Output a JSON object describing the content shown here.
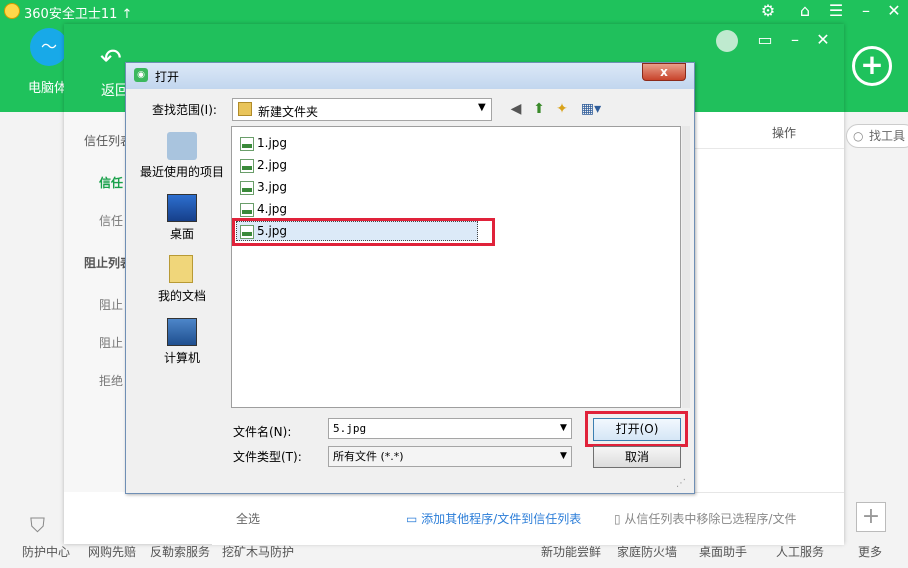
{
  "app": {
    "title": "360安全卫士11 ↑",
    "tool_label": "电脑体",
    "big_plus": "+"
  },
  "inner": {
    "back_icon": "↶",
    "back_label": "返回",
    "sidebar": {
      "trust_header": "信任列表",
      "trust_items": [
        "信任",
        "信任"
      ],
      "block_header": "阻止列表",
      "block_items": [
        "阻止",
        "阻止",
        "拒绝"
      ]
    },
    "column_header_op": "操作",
    "search_placeholder": "找工具",
    "select_all": "全选",
    "add_link": "添加其他程序/文件到信任列表",
    "remove_link": "从信任列表中移除已选程序/文件",
    "add_plus": "+"
  },
  "bottom": {
    "items": [
      "防护中心",
      "网购先赔",
      "反勒索服务",
      "挖矿木马防护",
      "新功能尝鲜",
      "家庭防火墙",
      "桌面助手",
      "人工服务",
      "更多"
    ]
  },
  "dialog": {
    "title": "打开",
    "close": "x",
    "look_in_label": "查找范围(I):",
    "look_in_value": "新建文件夹",
    "places": [
      "最近使用的项目",
      "桌面",
      "我的文档",
      "计算机"
    ],
    "files": [
      "1.jpg",
      "2.jpg",
      "3.jpg",
      "4.jpg",
      "5.jpg"
    ],
    "filename_label": "文件名(N):",
    "filename_value": "5.jpg",
    "filetype_label": "文件类型(T):",
    "filetype_value": "所有文件 (*.*)",
    "open_label": "打开(O)",
    "cancel_label": "取消"
  },
  "colors": {
    "green": "#1fc25c",
    "highlight_red": "#e0223a",
    "link_blue": "#2c7ed8"
  }
}
